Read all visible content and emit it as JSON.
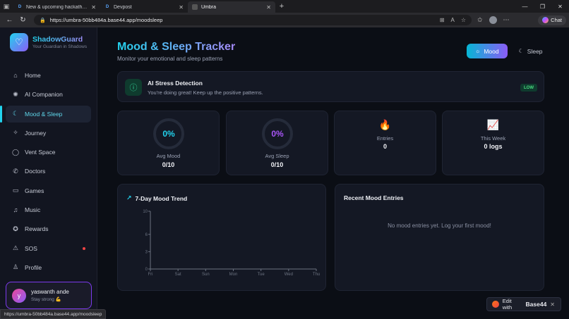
{
  "browser": {
    "tabs": [
      {
        "title": "New & upcoming hackathons - D",
        "favicon": "D"
      },
      {
        "title": "Devpost",
        "favicon": "D"
      },
      {
        "title": "Umbra",
        "favicon": "U"
      }
    ],
    "url": "https://umbra-50bb484a.base44.app/moodsleep",
    "chat_label": "Chat",
    "status_url": "https://umbra-50bb484a.base44.app/moodsleep"
  },
  "brand": {
    "name": "ShadowGuard",
    "tagline": "Your Guardian in Shadows"
  },
  "sidebar": {
    "items": [
      {
        "label": "Home",
        "icon": "home-icon"
      },
      {
        "label": "AI Companion",
        "icon": "brain-icon"
      },
      {
        "label": "Mood & Sleep",
        "icon": "moon-icon"
      },
      {
        "label": "Journey",
        "icon": "sparkle-icon"
      },
      {
        "label": "Vent Space",
        "icon": "chat-bubble-icon"
      },
      {
        "label": "Doctors",
        "icon": "phone-icon"
      },
      {
        "label": "Games",
        "icon": "gamepad-icon"
      },
      {
        "label": "Music",
        "icon": "music-icon"
      },
      {
        "label": "Rewards",
        "icon": "award-icon"
      },
      {
        "label": "SOS",
        "icon": "alert-triangle-icon"
      },
      {
        "label": "Profile",
        "icon": "user-icon"
      }
    ],
    "active_index": 2
  },
  "user": {
    "initial": "y",
    "name": "yaswanth ande",
    "subtitle": "Stay strong 💪"
  },
  "page": {
    "title": "Mood & Sleep Tracker",
    "subtitle": "Monitor your emotional and sleep patterns",
    "toggle": {
      "mood": "Mood",
      "sleep": "Sleep",
      "selected": "Mood"
    }
  },
  "stress": {
    "title": "AI Stress Detection",
    "message": "You're doing great! Keep up the positive patterns.",
    "level": "LOW"
  },
  "stats": {
    "avg_mood": {
      "percent": "0%",
      "label": "Avg Mood",
      "value": "0/10"
    },
    "avg_sleep": {
      "percent": "0%",
      "label": "Avg Sleep",
      "value": "0/10"
    },
    "entries": {
      "label": "Entries",
      "value": "0"
    },
    "this_week": {
      "label": "This Week",
      "value": "0 logs"
    }
  },
  "chart_data": {
    "type": "line",
    "title": "7-Day Mood Trend",
    "categories": [
      "Fri",
      "Sat",
      "Sun",
      "Mon",
      "Tue",
      "Wed",
      "Thu"
    ],
    "yticks": [
      0,
      3,
      6,
      10
    ],
    "ylim": [
      0,
      10
    ],
    "values": [],
    "grid": false
  },
  "recent": {
    "title": "Recent Mood Entries",
    "empty": "No mood entries yet. Log your first mood!"
  },
  "edit_pill": {
    "prefix": "Edit with",
    "brand": "Base44"
  },
  "colors": {
    "accent_cyan": "#22d3ee",
    "accent_purple": "#a855f7",
    "success": "#4ade80",
    "danger": "#ef4444"
  }
}
